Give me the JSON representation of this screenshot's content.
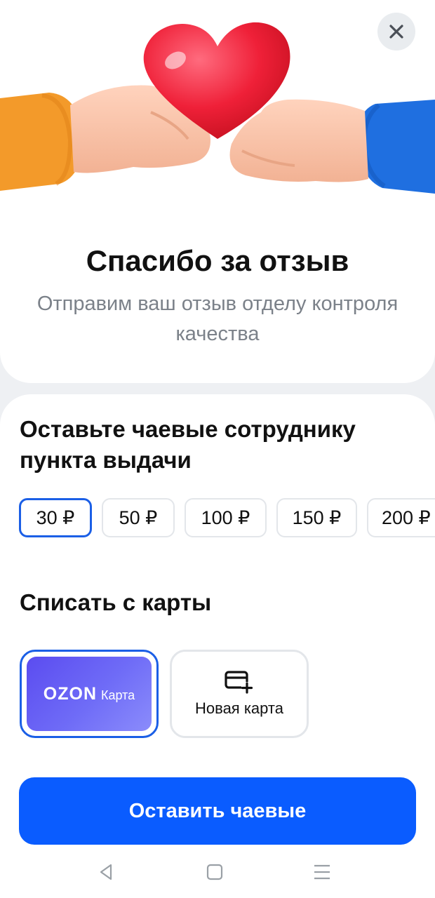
{
  "header": {
    "title": "Спасибо за отзыв",
    "subtitle": "Отправим ваш отзыв отделу контроля качества"
  },
  "tips": {
    "title": "Оставьте чаевые сотруднику пункта выдачи",
    "amounts": [
      "30 ₽",
      "50 ₽",
      "100 ₽",
      "150 ₽",
      "200 ₽"
    ],
    "selected_index": 0
  },
  "payment": {
    "title": "Списать с карты",
    "ozon_card": {
      "brand": "OZON",
      "label": "Карта"
    },
    "new_card_label": "Новая карта"
  },
  "cta": {
    "label": "Оставить чаевые"
  },
  "icons": {
    "close": "close-icon",
    "hero": "heart-hands-illustration",
    "new_card": "card-plus-icon",
    "nav_back": "nav-back-icon",
    "nav_home": "nav-home-icon",
    "nav_menu": "nav-menu-icon"
  },
  "colors": {
    "accent": "#0a5cff",
    "selected_border": "#1b5fe6",
    "heart": "#f0203a",
    "ozon_card": "#5b4cf0"
  }
}
